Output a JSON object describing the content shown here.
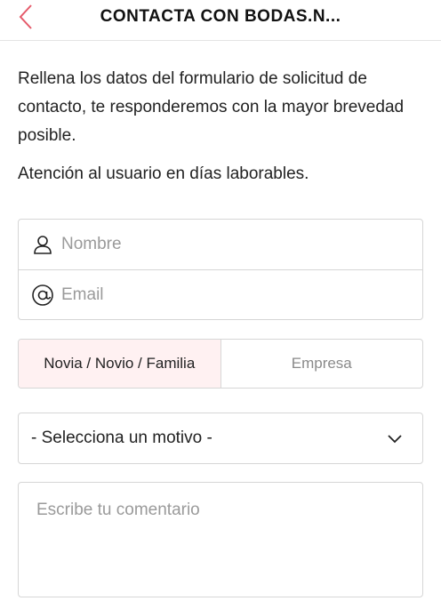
{
  "header": {
    "title": "CONTACTA CON BODAS.N...",
    "back_icon": "chevron-left-icon",
    "accent_color": "#e55a6a"
  },
  "intro": {
    "description": "Rellena los datos del formulario de solicitud de contacto, te responderemos con la mayor brevedad posible.",
    "notice": "Atención al usuario en días laborables."
  },
  "form": {
    "name": {
      "placeholder": "Nombre",
      "value": "",
      "icon": "user-icon"
    },
    "email": {
      "placeholder": "Email",
      "value": "",
      "icon": "at-icon"
    },
    "user_type": {
      "options": [
        "Novia / Novio / Familia",
        "Empresa"
      ],
      "selected": "Novia / Novio / Familia",
      "active_bg": "#fff1f2"
    },
    "reason": {
      "selected": "- Selecciona un motivo -",
      "icon": "chevron-down-icon"
    },
    "comment": {
      "placeholder": "Escribe tu comentario",
      "value": ""
    }
  }
}
